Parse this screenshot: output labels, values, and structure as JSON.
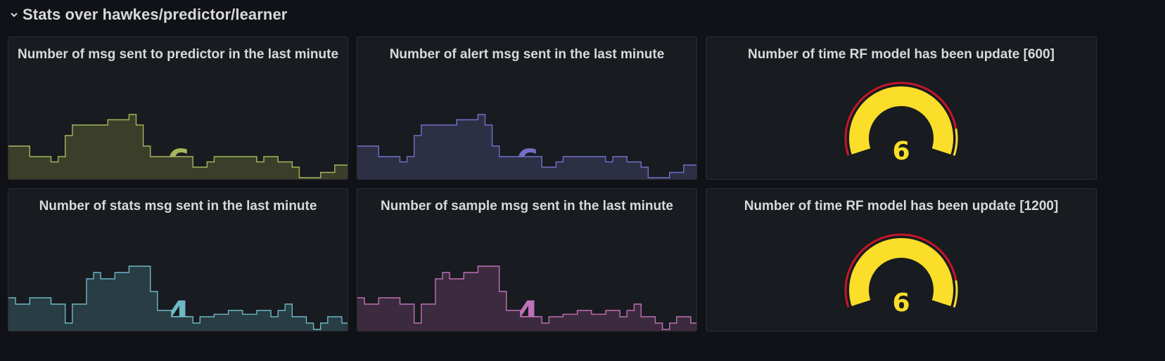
{
  "row": {
    "title": "Stats over hawkes/predictor/learner",
    "icon": "chevron-down-icon"
  },
  "panels": [
    {
      "title": "Number of msg sent to predictor in the last minute",
      "value": "6",
      "color": "#a7b55c",
      "fill": "#3b3f2a",
      "series": [
        2,
        2,
        2,
        1,
        1,
        1,
        0.5,
        1,
        3,
        4,
        4,
        4,
        4,
        4,
        4.5,
        4.5,
        4.5,
        5,
        4,
        2,
        1,
        1,
        1,
        1,
        1,
        1,
        0,
        0,
        0.5,
        1,
        1,
        1,
        1,
        1,
        1,
        0.5,
        1,
        1,
        0.5,
        0.5,
        0,
        -1,
        -1,
        -1,
        -0.5,
        -0.5,
        0.2,
        0.2,
        0.2
      ]
    },
    {
      "title": "Number of alert msg sent in the last minute",
      "value": "6",
      "color": "#7470c8",
      "fill": "#2d2f45",
      "series": [
        2,
        2,
        2,
        1,
        1,
        1,
        0.5,
        1,
        3,
        4,
        4,
        4,
        4,
        4,
        4.5,
        4.5,
        4.5,
        5,
        4,
        2,
        1,
        1,
        1,
        1,
        1,
        1,
        0,
        0,
        0.5,
        1,
        1,
        1,
        1,
        1,
        1,
        0.5,
        1,
        1,
        0.5,
        0.5,
        0,
        -1,
        -1,
        -1,
        -0.5,
        -0.5,
        0.2,
        0.2,
        0.2
      ]
    },
    {
      "title": "Number of time RF model has been update [600]",
      "value": "6",
      "type": "gauge",
      "color": "#fade2a",
      "threshold": "#c4162a"
    },
    {
      "title": "Number of stats msg sent in the last minute",
      "value": "4",
      "color": "#6fb8c6",
      "fill": "#283d44",
      "series": [
        1.5,
        1,
        1,
        1.5,
        1.5,
        1.5,
        1,
        1,
        -0.5,
        1,
        1,
        3,
        3.5,
        3,
        3,
        3.5,
        3.5,
        4,
        4,
        4,
        2,
        0.5,
        0.5,
        0,
        0,
        0,
        -0.5,
        0,
        0,
        0.2,
        0.2,
        0.5,
        0.5,
        0.2,
        0.2,
        0.5,
        0.5,
        0,
        0.5,
        1,
        0,
        0,
        -0.5,
        -1,
        -0.5,
        0,
        0,
        -0.5,
        -0.5
      ]
    },
    {
      "title": "Number of sample msg sent in the last minute",
      "value": "4",
      "color": "#c070b8",
      "fill": "#3c2b3e",
      "series": [
        1.5,
        1,
        1,
        1.5,
        1.5,
        1.5,
        1,
        1,
        -0.5,
        1,
        1,
        3,
        3.5,
        3,
        3,
        3.5,
        3.5,
        4,
        4,
        4,
        2,
        0.5,
        0.5,
        0,
        0,
        0,
        -0.5,
        0,
        0,
        0.2,
        0.2,
        0.5,
        0.5,
        0.2,
        0.2,
        0.5,
        0.5,
        0,
        0.5,
        1,
        0,
        0,
        -0.5,
        -1,
        -0.5,
        0,
        0,
        -0.5,
        -0.5
      ]
    },
    {
      "title": "Number of time RF model has been update [1200]",
      "value": "6",
      "type": "gauge",
      "color": "#fade2a",
      "threshold": "#c4162a"
    }
  ]
}
